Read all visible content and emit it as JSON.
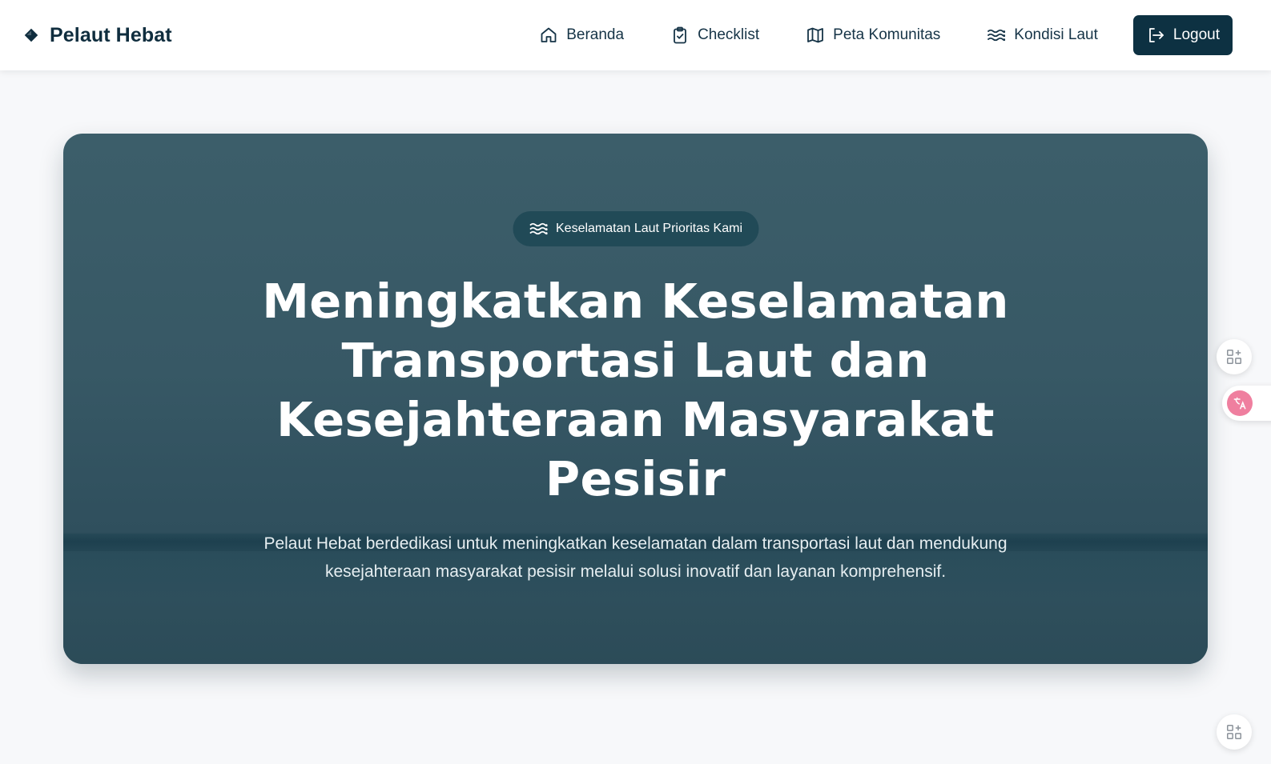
{
  "brand": {
    "name": "Pelaut Hebat",
    "icon": "diamond-logo-icon"
  },
  "nav": {
    "items": [
      {
        "label": "Beranda",
        "icon": "home-icon"
      },
      {
        "label": "Checklist",
        "icon": "clipboard-check-icon"
      },
      {
        "label": "Peta Komunitas",
        "icon": "map-icon"
      },
      {
        "label": "Kondisi Laut",
        "icon": "waves-icon"
      }
    ],
    "logout": {
      "label": "Logout",
      "icon": "logout-icon"
    }
  },
  "hero": {
    "badge": "Keselamatan Laut Prioritas Kami",
    "title": "Meningkatkan Keselamatan Transportasi Laut dan Kesejahteraan Masyarakat Pesisir",
    "description": "Pelaut Hebat berdedikasi untuk meningkatkan keselamatan dalam transportasi laut dan mendukung kesejahteraan masyarakat pesisir melalui solusi inovatif dan layanan komprehensif."
  },
  "colors": {
    "navy": "#0d3142",
    "hero_bg": "#375865",
    "page_bg": "#f7f8fa",
    "translate_accent": "#ef7f9f"
  }
}
